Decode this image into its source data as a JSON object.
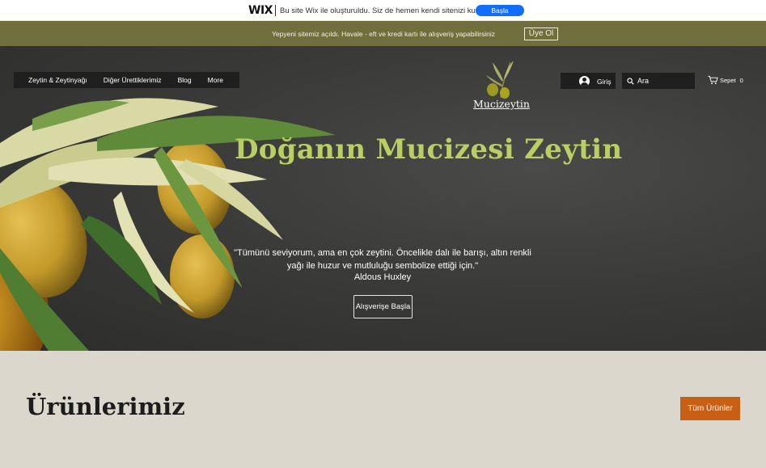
{
  "wix_banner": {
    "logo": "WIX",
    "message": "Bu site Wix ile oluşturuldu. Siz de hemen kendi sitenizi kurun.",
    "cta_label": "Başla"
  },
  "announcement": {
    "text": "Yepyeni sitemiz açıldı. Havale - eft ve kredi kartı ile alışveriş yapabilirsiniz",
    "member_label": "Üye Ol"
  },
  "nav": {
    "items": [
      {
        "label": "Zeytin & Zeytinyağı"
      },
      {
        "label": "Diğer Ürettiklerimiz"
      },
      {
        "label": "Blog"
      },
      {
        "label": "More"
      }
    ]
  },
  "brand": {
    "name": "Mucizeytin",
    "icon": "olive-branch-icon"
  },
  "login": {
    "label": "Giriş",
    "icon": "user-avatar-icon"
  },
  "search": {
    "placeholder": "Ara",
    "icon": "search-icon"
  },
  "cart": {
    "label": "Sepet",
    "count": "0",
    "icon": "cart-icon"
  },
  "hero": {
    "title": "Doğanın Mucizesi Zeytin",
    "quote_lines": [
      "\"Tümünü seviyorum, ama en çok zeytini. Öncelikle dalı ile barışı, altın renkli",
      "yağı ile huzur ve mutluluğu sembolize ettiği için.\""
    ],
    "quote_author": "Aldous Huxley",
    "cta_label": "Alışverişe Başla",
    "title_color": "#b9cf62"
  },
  "products": {
    "title": "Ürünlerimiz",
    "all_label": "Tüm Ürünler",
    "accent_color": "#c85f15"
  }
}
